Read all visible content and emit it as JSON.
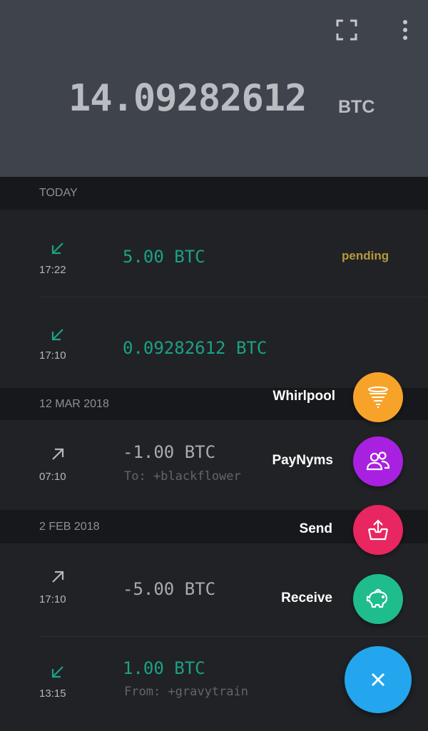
{
  "balance": {
    "amount": "14.09282612",
    "unit": "BTC"
  },
  "header_icons": [
    "scan-icon",
    "more-vertical-icon"
  ],
  "sections": [
    {
      "label": "TODAY"
    },
    {
      "label": "12 MAR 2018"
    },
    {
      "label": "2 FEB 2018"
    }
  ],
  "transactions": [
    {
      "direction": "incoming",
      "time": "17:22",
      "amount": "5.00 BTC",
      "status": "pending",
      "note": ""
    },
    {
      "direction": "incoming",
      "time": "17:10",
      "amount": "0.09282612 BTC",
      "status": "",
      "note": ""
    },
    {
      "direction": "outgoing",
      "time": "07:10",
      "amount": "-1.00 BTC",
      "status": "",
      "note": "To: +blackflower"
    },
    {
      "direction": "outgoing",
      "time": "17:10",
      "amount": "-5.00 BTC",
      "status": "",
      "note": ""
    },
    {
      "direction": "incoming",
      "time": "13:15",
      "amount": "1.00 BTC",
      "status": "",
      "note": "From: +gravytrain"
    }
  ],
  "fab_menu": [
    {
      "label": "Whirlpool",
      "icon": "tornado-icon",
      "color": "#f7a32a"
    },
    {
      "label": "PayNyms",
      "icon": "people-icon",
      "color": "#a921e0"
    },
    {
      "label": "Send",
      "icon": "send-tray-icon",
      "color": "#e8265f"
    },
    {
      "label": "Receive",
      "icon": "piggy-bank-icon",
      "color": "#1fbd8e"
    }
  ],
  "fab_main": {
    "icon": "close-icon",
    "color": "#24a6ee"
  },
  "colors": {
    "header_bg": "#3f434c",
    "list_bg": "#212226",
    "incoming": "#1aa286",
    "outgoing": "#a8abb0",
    "pending": "#b59a3a"
  }
}
